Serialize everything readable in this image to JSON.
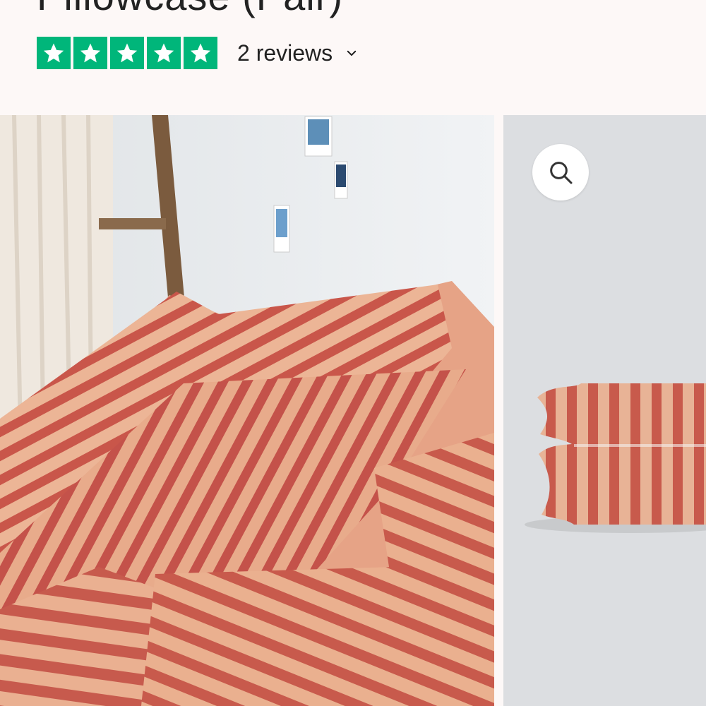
{
  "product": {
    "title": "Pillowcase (Pair)"
  },
  "rating": {
    "stars": 5,
    "max_stars": 5,
    "star_color": "#00b67a",
    "reviews_label": "2 reviews",
    "icon": "chevron-down-icon"
  },
  "gallery": {
    "images": [
      {
        "name": "bed-lifestyle-photo",
        "description_icon": "photo"
      },
      {
        "name": "pillowcase-pair-photo",
        "description_icon": "photo"
      }
    ],
    "zoom_icon": "magnifier-icon"
  },
  "colors": {
    "stripe_dark": "#c9564a",
    "stripe_light": "#e9a98a",
    "background": "#fdf8f7"
  }
}
